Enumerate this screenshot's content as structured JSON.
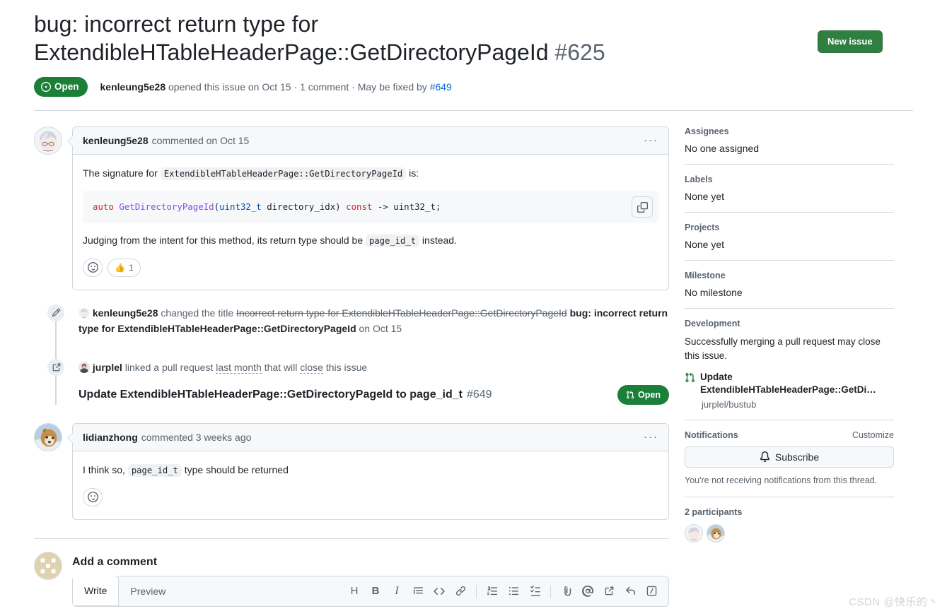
{
  "header": {
    "title": "bug: incorrect return type for ExtendibleHTableHeaderPage::GetDirectoryPageId",
    "issue_number": "#625",
    "new_issue_label": "New issue",
    "state": "Open",
    "meta_author": "kenleung5e28",
    "meta_opened": "opened this issue on Oct 15",
    "meta_sep1": "·",
    "meta_comments": "1 comment",
    "meta_sep2": "·",
    "meta_fixed_by": "May be fixed by",
    "meta_fix_link": "#649"
  },
  "comments": [
    {
      "author": "kenleung5e28",
      "meta": "commented on Oct 15",
      "kebab": "···",
      "para1_pre": "The signature for ",
      "para1_code": "ExtendibleHTableHeaderPage::GetDirectoryPageId",
      "para1_post": " is:",
      "code": {
        "kw1": "auto",
        "fn": "GetDirectoryPageId",
        "paren_open": "(",
        "ty1": "uint32_t",
        "arg": " directory_idx) ",
        "kw2": "const",
        "tail": " -> uint32_t;"
      },
      "para2_pre": "Judging from the intent for this method, its return type should be ",
      "para2_code": "page_id_t",
      "para2_post": " instead.",
      "reaction_emoji": "👍",
      "reaction_count": "1"
    },
    {
      "author": "lidianzhong",
      "meta": "commented 3 weeks ago",
      "kebab": "···",
      "para1_pre": "I think so, ",
      "para1_code": "page_id_t",
      "para1_post": " type should be returned"
    }
  ],
  "timeline": [
    {
      "icon": "pencil-icon",
      "actor": "kenleung5e28",
      "action": " changed the title ",
      "old_title": "Incorrect return type for ExtendibleHTableHeaderPage::GetDirectoryPageId",
      "new_title": " bug: incorrect return type for ExtendibleHTableHeaderPage::GetDirectoryPageId",
      "when": " on Oct 15"
    },
    {
      "icon": "cross-reference-icon",
      "actor": "jurplel",
      "action": " linked a pull request ",
      "when_link": "last month",
      "action_tail": " that will ",
      "close_word": "close",
      "action_tail2": " this issue",
      "pr_title": "Update ExtendibleHTableHeaderPage::GetDirectoryPageId to page_id_t",
      "pr_number": "#649",
      "pr_state": "Open"
    }
  ],
  "add_comment": {
    "heading": "Add a comment",
    "tab_write": "Write",
    "tab_preview": "Preview",
    "toolbar": [
      {
        "name": "heading-icon",
        "glyph": "H"
      },
      {
        "name": "bold-icon",
        "glyph": "B"
      },
      {
        "name": "italic-icon",
        "glyph": "I"
      },
      {
        "name": "quote-icon",
        "glyph": "quote"
      },
      {
        "name": "code-icon",
        "glyph": "<>"
      },
      {
        "name": "link-icon",
        "glyph": "link"
      },
      {
        "name": "ordered-list-icon",
        "glyph": "ol"
      },
      {
        "name": "unordered-list-icon",
        "glyph": "ul"
      },
      {
        "name": "task-list-icon",
        "glyph": "task"
      },
      {
        "name": "attach-file-icon",
        "glyph": "clip"
      },
      {
        "name": "mention-icon",
        "glyph": "@"
      },
      {
        "name": "reference-icon",
        "glyph": "ref"
      },
      {
        "name": "reply-icon",
        "glyph": "reply"
      },
      {
        "name": "slash-command-icon",
        "glyph": "slash"
      }
    ]
  },
  "sidebar": {
    "assignees": {
      "title": "Assignees",
      "value": "No one assigned"
    },
    "labels": {
      "title": "Labels",
      "value": "None yet"
    },
    "projects": {
      "title": "Projects",
      "value": "None yet"
    },
    "milestone": {
      "title": "Milestone",
      "value": "No milestone"
    },
    "development": {
      "title": "Development",
      "note": "Successfully merging a pull request may close this issue.",
      "pr_title": "Update ExtendibleHTableHeaderPage::GetDi…",
      "pr_repo": "jurplel/bustub"
    },
    "notifications": {
      "title": "Notifications",
      "customize": "Customize",
      "subscribe": "Subscribe",
      "note": "You're not receiving notifications from this thread."
    },
    "participants": {
      "title": "2 participants"
    }
  },
  "watermark": "CSDN @快乐的丶",
  "colors": {
    "open_green": "#1a7f37",
    "btn_green": "#2f7f41",
    "link_blue": "#0969da",
    "muted": "#59636e",
    "border": "#d1d9e0",
    "code_kw": "#cf222e",
    "code_fn": "#8250df",
    "code_ty": "#0550ae"
  }
}
